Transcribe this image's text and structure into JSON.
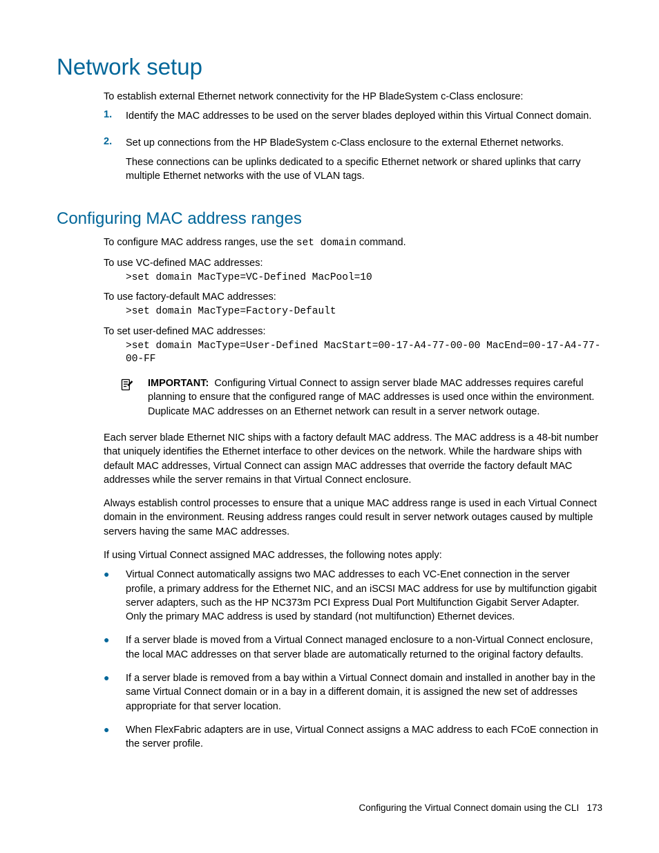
{
  "heading_main": "Network setup",
  "intro": "To establish external Ethernet network connectivity for the HP BladeSystem c-Class enclosure:",
  "steps": [
    {
      "marker": "1.",
      "paras": [
        "Identify the MAC addresses to be used on the server blades deployed within this Virtual Connect domain."
      ]
    },
    {
      "marker": "2.",
      "paras": [
        "Set up connections from the HP BladeSystem c-Class enclosure to the external Ethernet networks.",
        "These connections can be uplinks dedicated to a specific Ethernet network or shared uplinks that carry multiple Ethernet networks with the use of VLAN tags."
      ]
    }
  ],
  "heading_sub": "Configuring MAC address ranges",
  "config_intro_pre": "To configure MAC address ranges, use the ",
  "config_intro_cmd": "set domain",
  "config_intro_post": " command.",
  "defs": [
    {
      "label": "To use VC-defined MAC addresses:",
      "code": ">set domain MacType=VC-Defined MacPool=10"
    },
    {
      "label": "To use factory-default MAC addresses:",
      "code": ">set domain MacType=Factory-Default"
    },
    {
      "label": "To set user-defined MAC addresses:",
      "code": ">set domain MacType=User-Defined MacStart=00-17-A4-77-00-00 MacEnd=00-17-A4-77-00-FF"
    }
  ],
  "important_label": "IMPORTANT:",
  "important_text": "Configuring Virtual Connect to assign server blade MAC addresses requires careful planning to ensure that the configured range of MAC addresses is used once within the environment. Duplicate MAC addresses on an Ethernet network can result in a server network outage.",
  "paras": [
    "Each server blade Ethernet NIC ships with a factory default MAC address. The MAC address is a 48-bit number that uniquely identifies the Ethernet interface to other devices on the network. While the hardware ships with default MAC addresses, Virtual Connect can assign MAC addresses that override the factory default MAC addresses while the server remains in that Virtual Connect enclosure.",
    "Always establish control processes to ensure that a unique MAC address range is used in each Virtual Connect domain in the environment. Reusing address ranges could result in server network outages caused by multiple servers having the same MAC addresses.",
    "If using Virtual Connect assigned MAC addresses, the following notes apply:"
  ],
  "bullets": [
    "Virtual Connect automatically assigns two MAC addresses to each VC-Enet connection in the server profile, a primary address for the Ethernet NIC, and an iSCSI MAC address for use by multifunction gigabit server adapters, such as the HP NC373m PCI Express Dual Port Multifunction Gigabit Server Adapter. Only the primary MAC address is used by standard (not multifunction) Ethernet devices.",
    "If a server blade is moved from a Virtual Connect managed enclosure to a non-Virtual Connect enclosure, the local MAC addresses on that server blade are automatically returned to the original factory defaults.",
    "If a server blade is removed from a bay within a Virtual Connect domain and installed in another bay in the same Virtual Connect domain or in a bay in a different domain, it is assigned the new set of addresses appropriate for that server location.",
    "When FlexFabric adapters are in use, Virtual Connect assigns a MAC address to each FCoE connection in the server profile."
  ],
  "footer_text": "Configuring the Virtual Connect domain using the CLI",
  "footer_page": "173"
}
